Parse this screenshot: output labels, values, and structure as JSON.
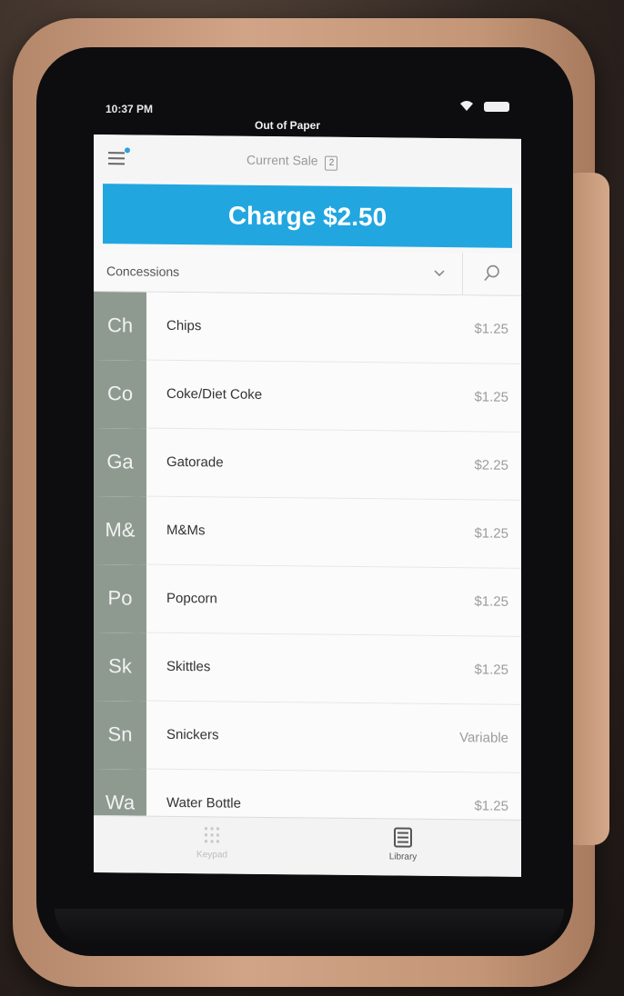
{
  "status_bar": {
    "time": "10:37 PM",
    "title": "Out of Paper"
  },
  "header": {
    "current_sale_label": "Current Sale",
    "cart_count": "2"
  },
  "charge_button": {
    "label": "Charge $2.50"
  },
  "category": {
    "selected": "Concessions"
  },
  "items": [
    {
      "abbr": "Ch",
      "name": "Chips",
      "price": "$1.25"
    },
    {
      "abbr": "Co",
      "name": "Coke/Diet Coke",
      "price": "$1.25"
    },
    {
      "abbr": "Ga",
      "name": "Gatorade",
      "price": "$2.25"
    },
    {
      "abbr": "M&",
      "name": "M&Ms",
      "price": "$1.25"
    },
    {
      "abbr": "Po",
      "name": "Popcorn",
      "price": "$1.25"
    },
    {
      "abbr": "Sk",
      "name": "Skittles",
      "price": "$1.25"
    },
    {
      "abbr": "Sn",
      "name": "Snickers",
      "price": "Variable"
    },
    {
      "abbr": "Wa",
      "name": "Water Bottle",
      "price": "$1.25"
    }
  ],
  "tabs": {
    "keypad_label": "Keypad",
    "library_label": "Library"
  },
  "colors": {
    "accent": "#21a6e0",
    "tile": "#8e9a90"
  },
  "icons": {
    "menu": "menu-icon",
    "search": "search-icon",
    "dropdown": "chevron-down-icon",
    "keypad": "keypad-icon",
    "library": "library-icon",
    "wifi": "wifi-icon",
    "battery": "battery-icon"
  }
}
